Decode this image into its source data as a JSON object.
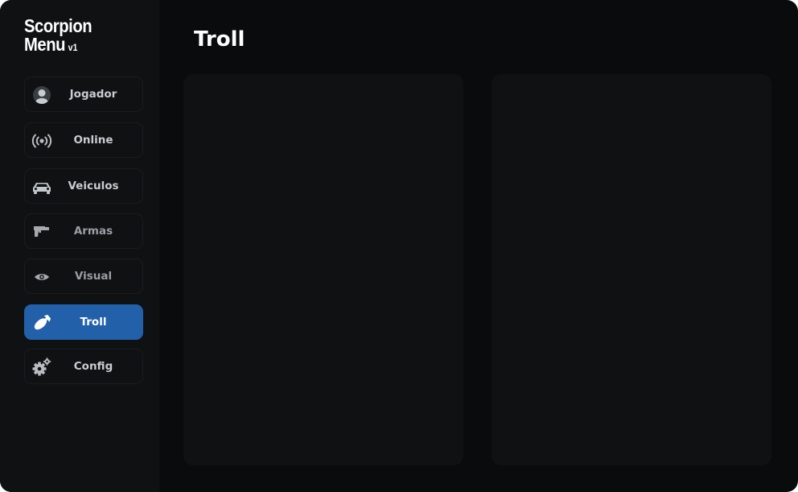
{
  "brand": {
    "line1": "Scorpion",
    "line2": "Menu",
    "version": "v1"
  },
  "sidebar": {
    "items": [
      {
        "label": "Jogador",
        "icon": "user-icon"
      },
      {
        "label": "Online",
        "icon": "broadcast-icon"
      },
      {
        "label": "Veiculos",
        "icon": "car-icon"
      },
      {
        "label": "Armas",
        "icon": "gun-icon"
      },
      {
        "label": "Visual",
        "icon": "eye-icon"
      },
      {
        "label": "Troll",
        "icon": "bomb-icon",
        "active": true
      },
      {
        "label": "Config",
        "icon": "gears-icon"
      }
    ]
  },
  "main": {
    "title": "Troll"
  },
  "colors": {
    "window_bg": "#0a0b0c",
    "sidebar_bg": "#0f1113",
    "panel_bg": "#0f1113",
    "accent": "#2360aa",
    "text": "#ffffff",
    "muted_text": "#c9ccd0"
  }
}
